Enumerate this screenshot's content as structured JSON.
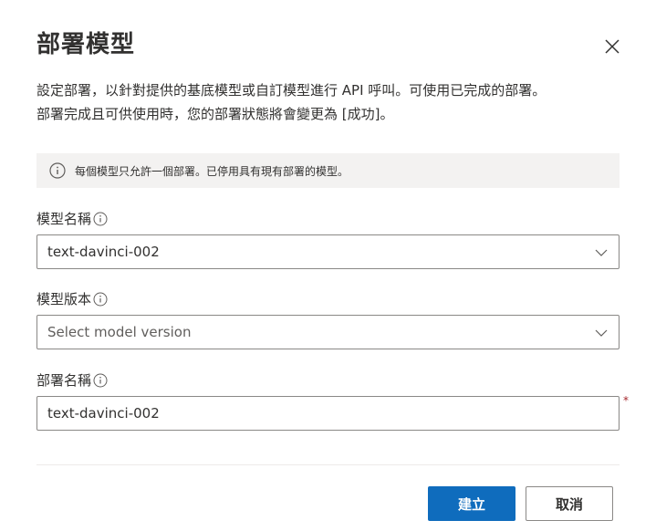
{
  "dialog": {
    "title": "部署模型",
    "close_icon": "close-icon",
    "description_line1": "設定部署，以針對提供的基底模型或自訂模型進行 API 呼叫。可使用已完成的部署。",
    "description_line2": "部署完成且可供使用時，您的部署狀態將會變更為 [成功]。",
    "info_text": "每個模型只允許一個部署。已停用具有現有部署的模型。"
  },
  "fields": {
    "model_name": {
      "label": "模型名稱",
      "value": "text-davinci-002"
    },
    "model_version": {
      "label": "模型版本",
      "placeholder": "Select model version"
    },
    "deployment_name": {
      "label": "部署名稱",
      "value": "text-davinci-002",
      "required_marker": "*"
    }
  },
  "buttons": {
    "create": "建立",
    "cancel": "取消"
  },
  "colors": {
    "primary": "#0f6cbd",
    "info_bg": "#f3f2f1",
    "required": "#a4262c"
  }
}
